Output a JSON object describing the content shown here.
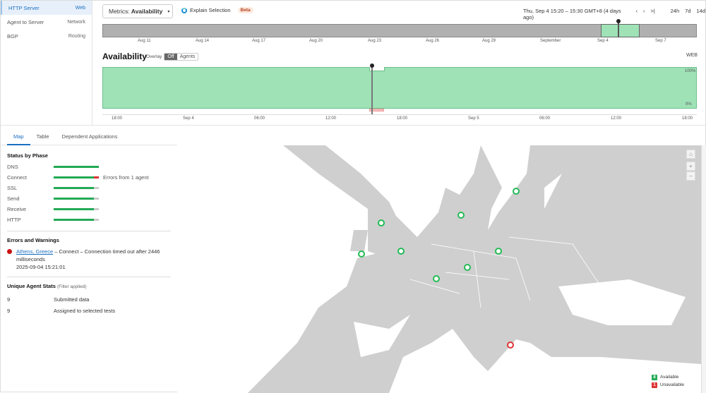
{
  "nav": [
    {
      "label": "HTTP Server",
      "type": "Web",
      "active": true
    },
    {
      "label": "Agent to Server",
      "type": "Network"
    },
    {
      "label": "BGP",
      "type": "Routing"
    }
  ],
  "toolbar": {
    "metrics_prefix": "Metrics:",
    "metrics_value": "Availability",
    "explain": "Explain Selection",
    "beta": "Beta",
    "time_range": "Thu, Sep 4 15:20 – 15:30 GMT+8 (4 days ago)",
    "prev": "‹",
    "next": "›",
    "last": ">|",
    "ranges": [
      "24h",
      "7d",
      "14d"
    ]
  },
  "timeline": {
    "ticks": [
      "Aug 11",
      "Aug 14",
      "Aug 17",
      "Aug 20",
      "Aug 23",
      "Aug 26",
      "Aug 29",
      "September",
      "Sep 4",
      "Sep 7"
    ]
  },
  "chart": {
    "title": "Availability",
    "overlay_label": "Overlay",
    "overlay_options": [
      "Off",
      "Agents"
    ],
    "overlay_selected": "Off",
    "layer": "WEB",
    "y_top": "100%",
    "y_bottom": "0%",
    "x_ticks": [
      "18:00",
      "Sep 4",
      "06:00",
      "12:00",
      "18:00",
      "Sep 5",
      "06:00",
      "12:00",
      "18:00"
    ]
  },
  "tabs": [
    "Map",
    "Table",
    "Dependent Applications"
  ],
  "status": {
    "title": "Status by Phase",
    "phases": [
      {
        "name": "DNS",
        "ok": 100,
        "err": 0
      },
      {
        "name": "Connect",
        "ok": 89,
        "err": 11,
        "note": "Errors from 1 agent"
      },
      {
        "name": "SSL",
        "ok": 89,
        "err": 0
      },
      {
        "name": "Send",
        "ok": 89,
        "err": 0
      },
      {
        "name": "Receive",
        "ok": 89,
        "err": 0
      },
      {
        "name": "HTTP",
        "ok": 89,
        "err": 0
      }
    ]
  },
  "errors": {
    "title": "Errors and Warnings",
    "location": "Athens, Greece",
    "message": " – Connect – Connection timed out after 2446 milliseconds",
    "time": "2025-09-04 15:21:01"
  },
  "stats": {
    "title": "Unique Agent Stats",
    "filter": "(Filter applied)",
    "rows": [
      {
        "n": "9",
        "label": "Submitted data"
      },
      {
        "n": "9",
        "label": "Assigned to selected tests"
      }
    ]
  },
  "legend": {
    "available_count": "8",
    "available": "Available",
    "unavailable_count": "1",
    "unavailable": "Unavailable"
  },
  "colors": {
    "accent": "#1a6fc2",
    "ok": "#22aa55",
    "error": "#dd3333",
    "chart": "#9ee2b6"
  }
}
